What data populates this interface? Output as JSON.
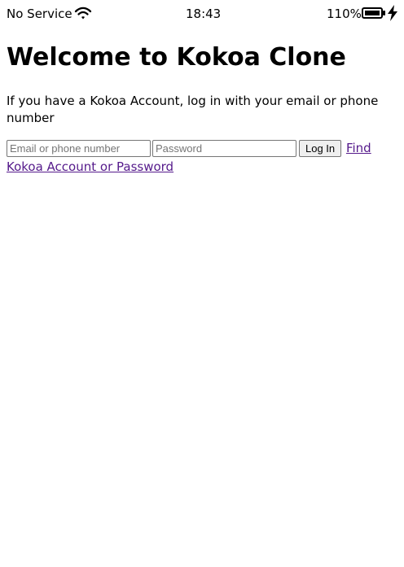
{
  "status_bar": {
    "carrier": "No Service",
    "time": "18:43",
    "battery_percent": "110%",
    "icons": {
      "wifi": "wifi-icon",
      "battery": "battery-full-icon",
      "charging": "charging-bolt-icon"
    }
  },
  "page": {
    "title": "Welcome to Kokoa Clone",
    "intro": "If you have a Kokoa Account, log in with your email or phone number"
  },
  "login_form": {
    "email_placeholder": "Email or phone number",
    "password_placeholder": "Password",
    "submit_label": "Log In",
    "find_link": "Find Kokoa Account or Password"
  },
  "colors": {
    "text": "#000000",
    "background": "#ffffff",
    "visited_link": "#551a8b",
    "button_background": "#efefef",
    "input_border": "#767676"
  }
}
